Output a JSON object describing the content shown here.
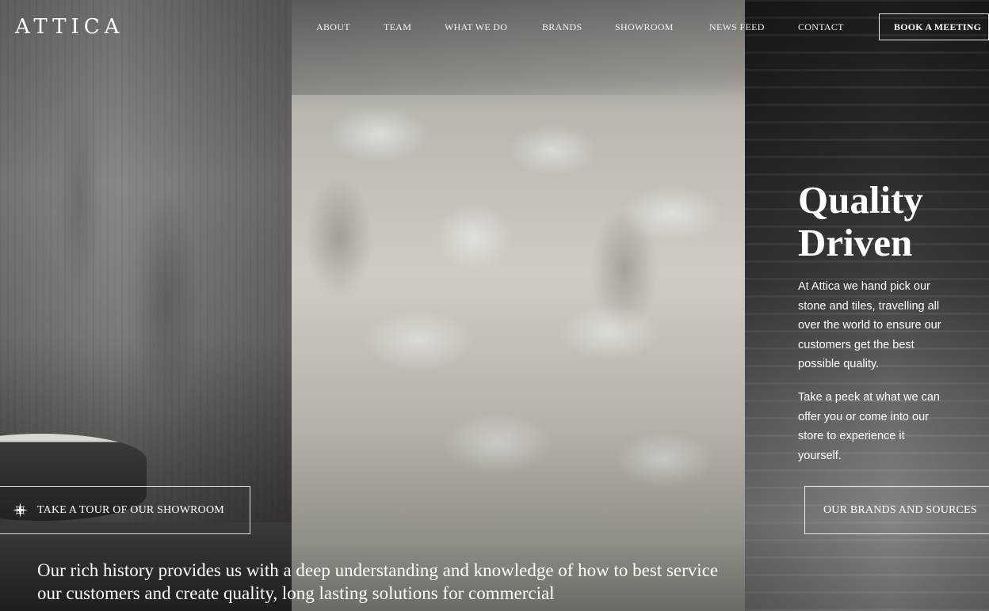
{
  "header": {
    "logo": "ATTICA",
    "nav": [
      {
        "label": "ABOUT"
      },
      {
        "label": "TEAM"
      },
      {
        "label": "WHAT WE DO"
      },
      {
        "label": "BRANDS"
      },
      {
        "label": "SHOWROOM"
      },
      {
        "label": "NEWS FEED"
      },
      {
        "label": "CONTACT"
      }
    ],
    "cta": "BOOK A MEETING"
  },
  "hero": {
    "title_line1": "Quality",
    "title_line2": "Driven",
    "paragraph1": "At Attica we hand pick our stone and tiles, travelling all over the world to ensure our customers get the best possible quality.",
    "paragraph2": "Take a peek at what we can offer you or come into our store to experience it yourself."
  },
  "buttons": {
    "tour": "TAKE A TOUR OF OUR SHOWROOM",
    "tour_icon": "sparkle-icon",
    "brands": "OUR BRANDS AND SOURCES"
  },
  "history": {
    "text": "Our rich history provides us with a deep understanding and knowledge of how to best service our customers and create quality, long lasting solutions for commercial"
  }
}
